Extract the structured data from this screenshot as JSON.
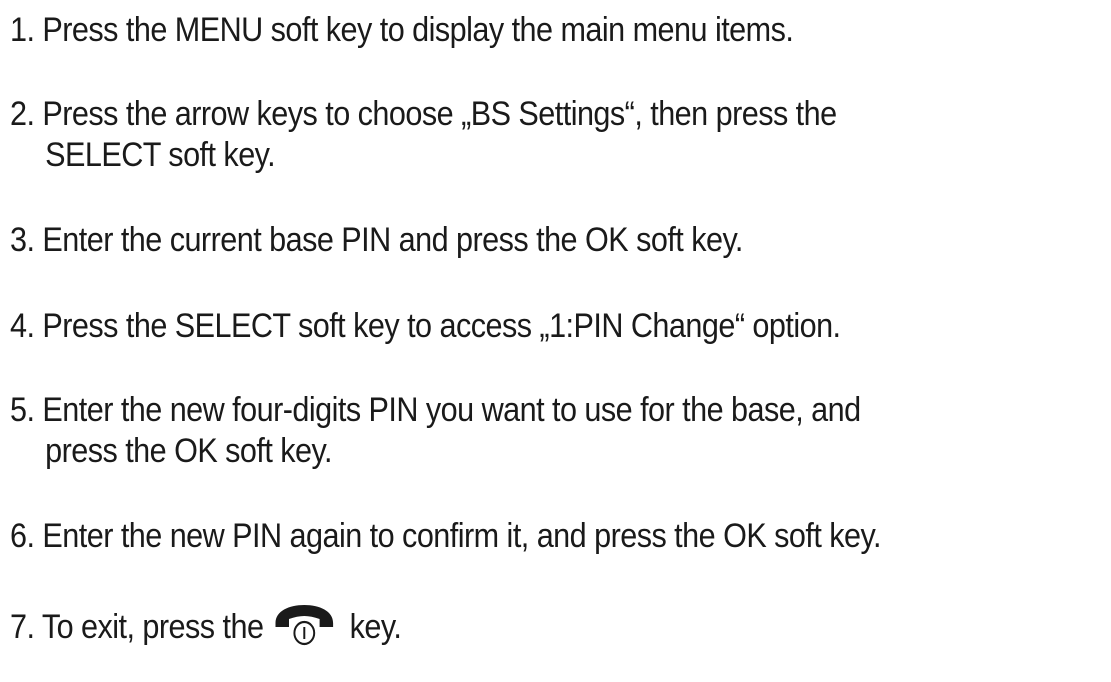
{
  "steps": [
    {
      "number": "1.",
      "line1": "Press the MENU soft key to display the main menu items."
    },
    {
      "number": "2.",
      "line1": "Press the arrow keys to choose „BS Settings“, then press the",
      "line2": "SELECT soft key."
    },
    {
      "number": "3.",
      "line1": "Enter the current base PIN and press the OK soft key."
    },
    {
      "number": "4.",
      "line1": "Press the SELECT soft key to access „1:PIN Change“ option."
    },
    {
      "number": "5.",
      "line1": "Enter the new four-digits PIN you want to use for the base, and",
      "line2": "press the OK soft key."
    },
    {
      "number": "6.",
      "line1": "Enter the new PIN again to confirm it, and press the OK soft key."
    },
    {
      "number": "7.",
      "before_icon": "To exit, press the",
      "icon": "end-call-key-icon",
      "after_icon": "key."
    }
  ]
}
